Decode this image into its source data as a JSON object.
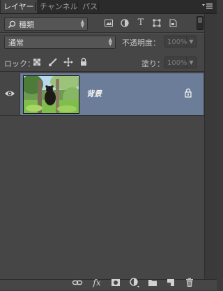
{
  "tabs": [
    {
      "label": "レイヤー",
      "active": true
    },
    {
      "label": "チャンネル",
      "active": false
    },
    {
      "label": "パス",
      "active": false
    }
  ],
  "panel_menu_icon": "menu-lines-icon",
  "filter": {
    "kind_label": "種類",
    "filter_icons": [
      "image-filter-icon",
      "adjustment-filter-icon",
      "type-filter-icon",
      "shape-filter-icon",
      "smart-object-filter-icon"
    ]
  },
  "blend": {
    "mode": "通常",
    "opacity_label": "不透明度：",
    "opacity_value": "100%"
  },
  "lock": {
    "label": "ロック：",
    "icons": [
      "lock-transparent-icon",
      "lock-image-icon",
      "lock-position-icon",
      "lock-all-icon"
    ],
    "fill_label": "塗り：",
    "fill_value": "100%"
  },
  "layers": [
    {
      "name": "背景",
      "visible": true,
      "locked": true,
      "selected": true
    }
  ],
  "bottom_icons": [
    "link-layers-icon",
    "fx-icon",
    "add-mask-icon",
    "adjustment-layer-icon",
    "new-group-icon",
    "new-layer-icon",
    "trash-icon"
  ],
  "fx_label": "fx",
  "colors": {
    "selected_row": "#6c7d99",
    "panel_bg": "#464646"
  }
}
